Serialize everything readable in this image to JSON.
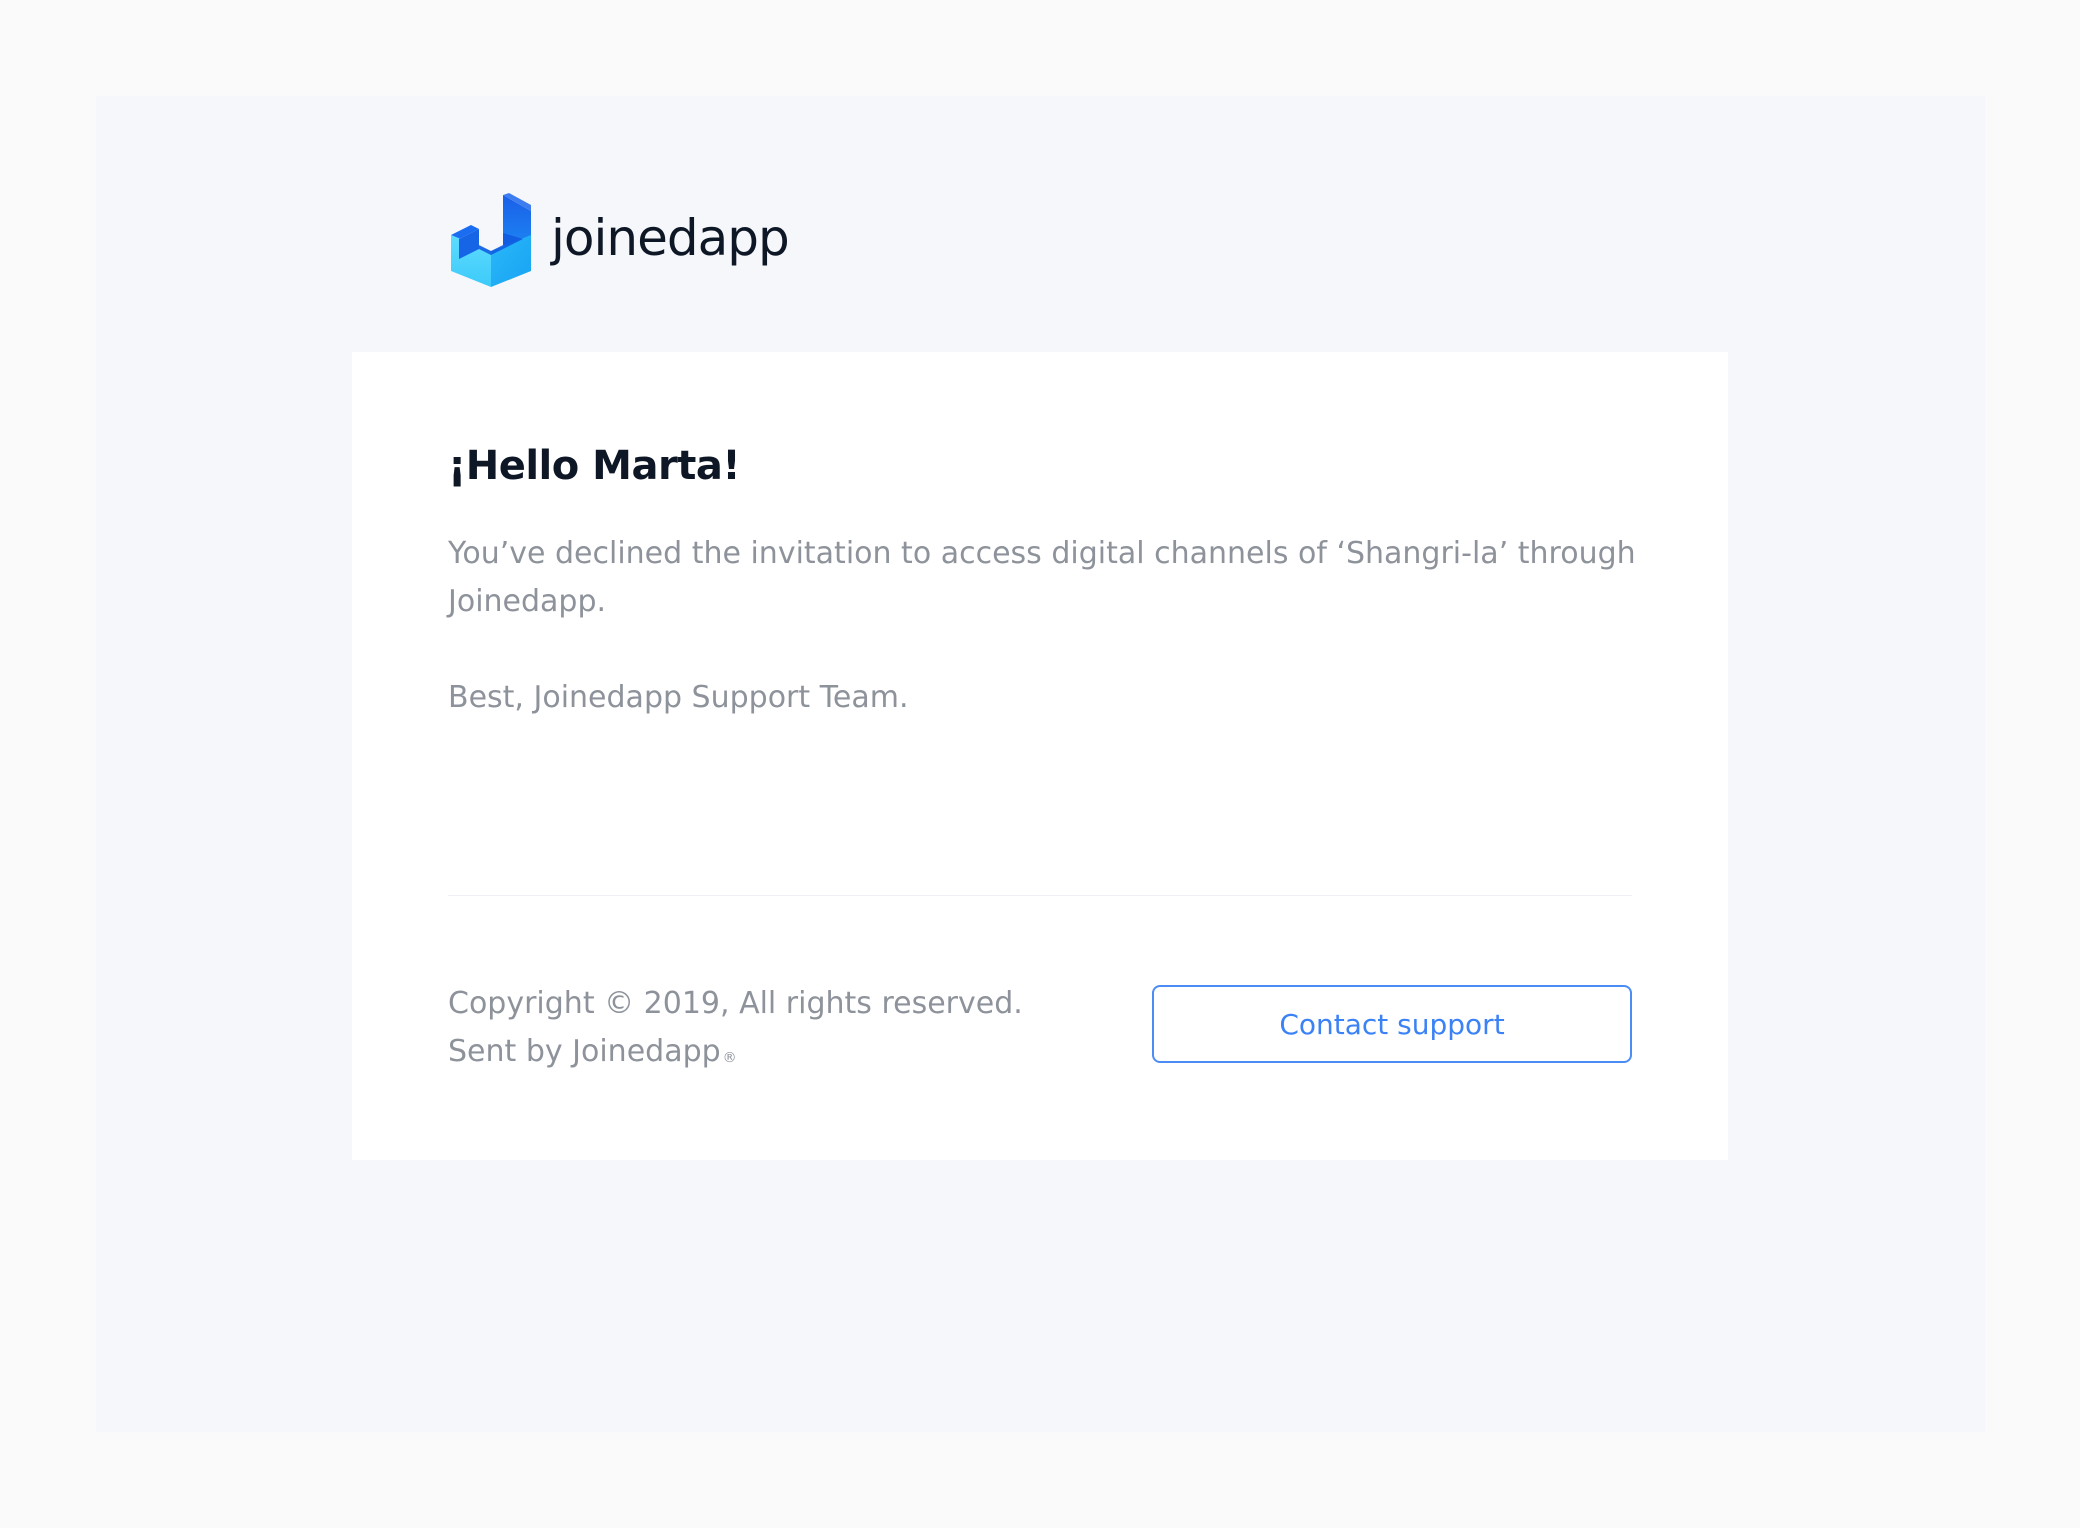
{
  "brand": {
    "name": "joinedapp",
    "logo_icon": "joinedapp-logo-icon",
    "colors": {
      "primary": "#1a6cf0",
      "light": "#54d3fa"
    }
  },
  "email": {
    "greeting": "¡Hello Marta!",
    "body": "You’ve declined the invitation to access digital channels of ‘Shangri-la’ through Joinedapp.",
    "signoff": "Best, Joinedapp Support Team."
  },
  "footer": {
    "copyright": "Copyright © 2019, All rights reserved.",
    "sent_by": "Sent by Joinedapp",
    "registered_mark": "®",
    "contact_button_label": "Contact support",
    "accent_color": "#3b82f6"
  }
}
